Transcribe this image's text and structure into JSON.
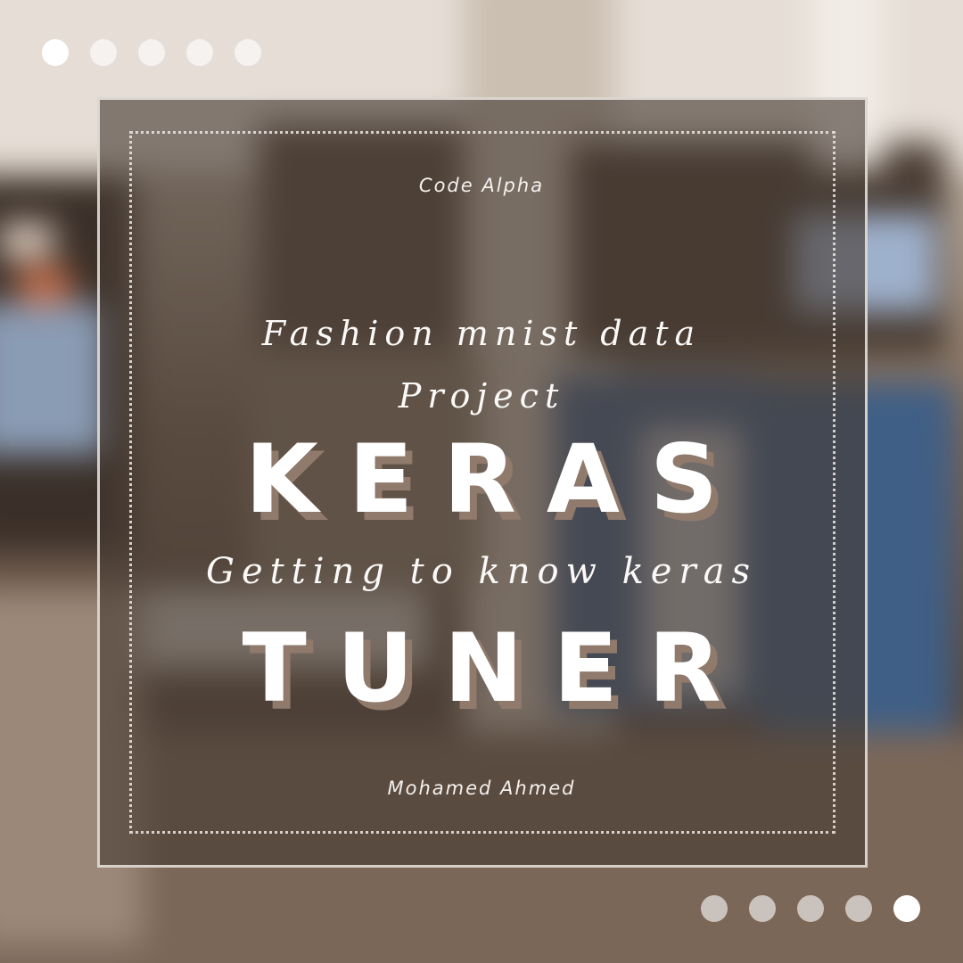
{
  "slide": {
    "brand": "Code Alpha",
    "subtitle_line_1": "Fashion mnist data",
    "subtitle_line_2": "Project",
    "headline_1": "KERAS",
    "tagline": "Getting to know keras",
    "headline_2": "TUNER",
    "author": "Mohamed Ahmed"
  },
  "pagination": {
    "top_dots": [
      {
        "active": true
      },
      {
        "active": false
      },
      {
        "active": false
      },
      {
        "active": false
      },
      {
        "active": false
      }
    ],
    "bottom_dots": [
      {
        "active": false
      },
      {
        "active": false
      },
      {
        "active": false
      },
      {
        "active": false
      },
      {
        "active": true
      }
    ]
  },
  "colors": {
    "overlay": "#463a32",
    "frame": "#ece7e2",
    "headline_shadow": "#8f7a6c",
    "text": "#ffffff"
  }
}
